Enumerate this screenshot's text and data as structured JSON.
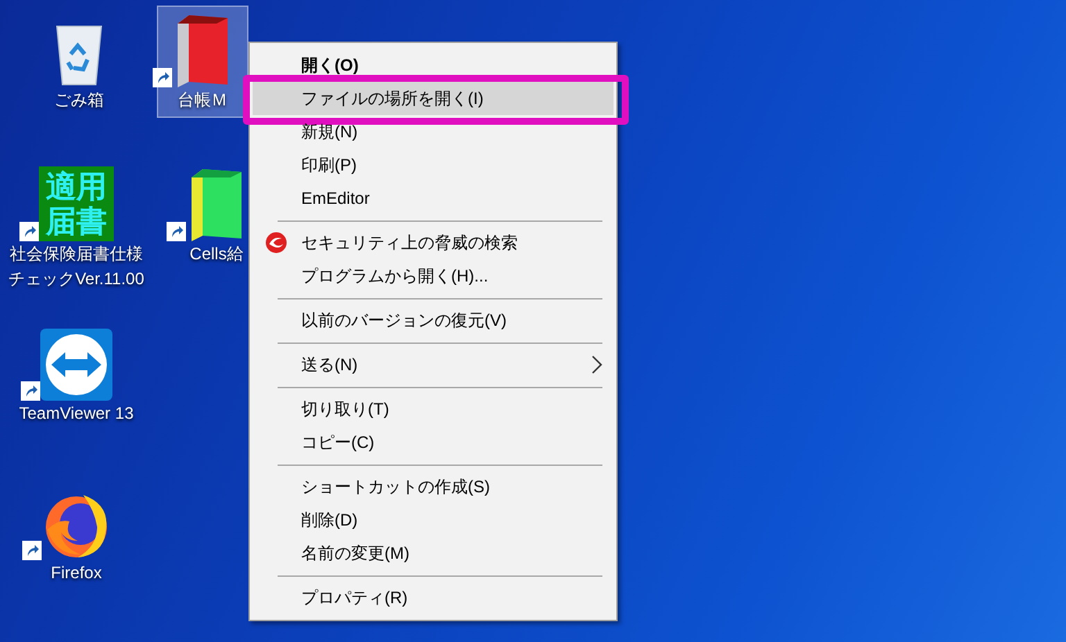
{
  "desktop": {
    "icons": [
      {
        "kind": "recycle_bin",
        "label": [
          "ごみ箱"
        ],
        "selected": false,
        "shortcut": false
      },
      {
        "kind": "red_binder",
        "label": [
          "台帳Ｍ"
        ],
        "selected": true,
        "shortcut": true
      },
      {
        "kind": "green_tile",
        "label": [
          "社会保険届書仕様",
          "チェックVer.11.00"
        ],
        "logo_lines": [
          "適用",
          "届書"
        ],
        "selected": false,
        "shortcut": true
      },
      {
        "kind": "green_binder",
        "label": [
          "Cells給"
        ],
        "selected": false,
        "shortcut": true
      },
      {
        "kind": "teamviewer",
        "label": [
          "TeamViewer 13"
        ],
        "selected": false,
        "shortcut": true
      },
      {
        "kind": "firefox",
        "label": [
          "Firefox"
        ],
        "selected": false,
        "shortcut": true
      }
    ]
  },
  "context_menu": {
    "items": [
      {
        "kind": "item",
        "label": "開く(O)",
        "default": true,
        "selected": false,
        "submenu": false
      },
      {
        "kind": "item",
        "label": "ファイルの場所を開く(I)",
        "default": false,
        "selected": true,
        "submenu": false
      },
      {
        "kind": "item",
        "label": "新規(N)",
        "default": false,
        "selected": false,
        "submenu": false
      },
      {
        "kind": "item",
        "label": "印刷(P)",
        "default": false,
        "selected": false,
        "submenu": false
      },
      {
        "kind": "item",
        "label": "EmEditor",
        "default": false,
        "selected": false,
        "submenu": false
      },
      {
        "kind": "separator"
      },
      {
        "kind": "icon_item",
        "label": "セキュリティ上の脅威の検索",
        "default": false,
        "selected": false,
        "submenu": false
      },
      {
        "kind": "item",
        "label": "プログラムから開く(H)...",
        "default": false,
        "selected": false,
        "submenu": false
      },
      {
        "kind": "separator"
      },
      {
        "kind": "item",
        "label": "以前のバージョンの復元(V)",
        "default": false,
        "selected": false,
        "submenu": false
      },
      {
        "kind": "separator"
      },
      {
        "kind": "item",
        "label": "送る(N)",
        "default": false,
        "selected": false,
        "submenu": true
      },
      {
        "kind": "separator"
      },
      {
        "kind": "item",
        "label": "切り取り(T)",
        "default": false,
        "selected": false,
        "submenu": false
      },
      {
        "kind": "item",
        "label": "コピー(C)",
        "default": false,
        "selected": false,
        "submenu": false
      },
      {
        "kind": "separator"
      },
      {
        "kind": "item",
        "label": "ショートカットの作成(S)",
        "default": false,
        "selected": false,
        "submenu": false
      },
      {
        "kind": "item",
        "label": "削除(D)",
        "default": false,
        "selected": false,
        "submenu": false
      },
      {
        "kind": "item",
        "label": "名前の変更(M)",
        "default": false,
        "selected": false,
        "submenu": false
      },
      {
        "kind": "separator"
      },
      {
        "kind": "item",
        "label": "プロパティ(R)",
        "default": false,
        "selected": false,
        "submenu": false
      }
    ]
  }
}
